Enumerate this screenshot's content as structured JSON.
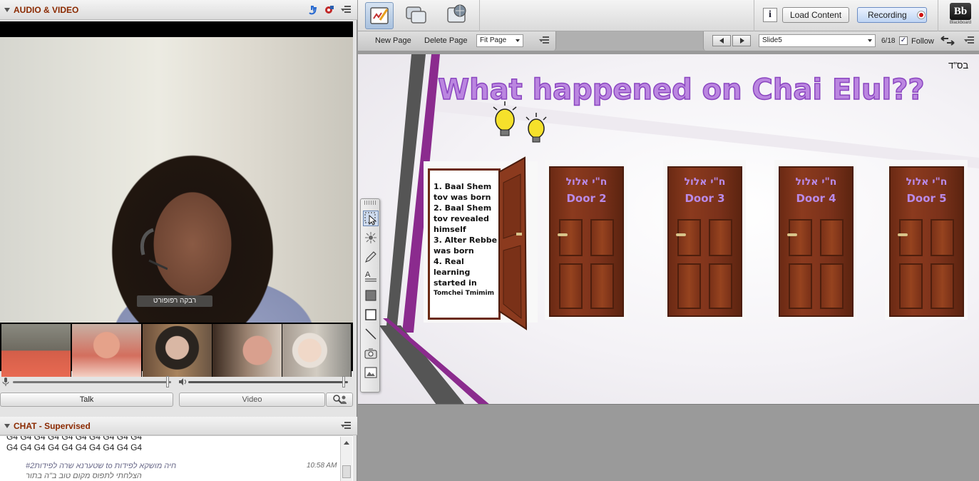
{
  "audio_video": {
    "title": "AUDIO & VIDEO",
    "main_participant_name": "רבקה רפופורט",
    "talk_label": "Talk",
    "video_label": "Video"
  },
  "chat": {
    "title": "CHAT - Supervised",
    "repeated_line": "G4 G4 G4 G4 G4 G4 G4 G4 G4 G4",
    "message_text": "שטערנא שרה לפידות#2 to חיה מושקא לפידות",
    "message_time": "10:58 AM",
    "message_line2": "הצלחתי לתפוס מקום טוב ב\"ה בתור"
  },
  "toolbar": {
    "load_content": "Load Content",
    "recording": "Recording",
    "info": "i",
    "bb_logo": "Bb",
    "bb_label": "Blackboard"
  },
  "subbar": {
    "new_page": "New Page",
    "delete_page": "Delete Page",
    "zoom": "Fit Page",
    "slide_name": "Slide5",
    "page_counter": "6/18",
    "follow": "Follow"
  },
  "slide": {
    "title": "What happened on Chai Elul??",
    "corner_text": "בס\"ד",
    "open_door_items": [
      "1. Baal Shem tov was born",
      "2. Baal Shem tov revealed himself",
      "3. Alter Rebbe was born",
      "4. Real learning started in"
    ],
    "open_door_small": "Tomchei Tmimim",
    "doors": [
      {
        "hebrew": "ח\"י אלול",
        "label": "Door 2"
      },
      {
        "hebrew": "ח\"י אלול",
        "label": "Door 3"
      },
      {
        "hebrew": "ח\"י אלול",
        "label": "Door 4"
      },
      {
        "hebrew": "ח\"י אלול",
        "label": "Door 5"
      }
    ]
  },
  "colors": {
    "accent_purple": "#bb86e0",
    "header_title": "#8b2a00",
    "recording_dot": "#d01010",
    "door_brown": "#8b3a1e"
  }
}
